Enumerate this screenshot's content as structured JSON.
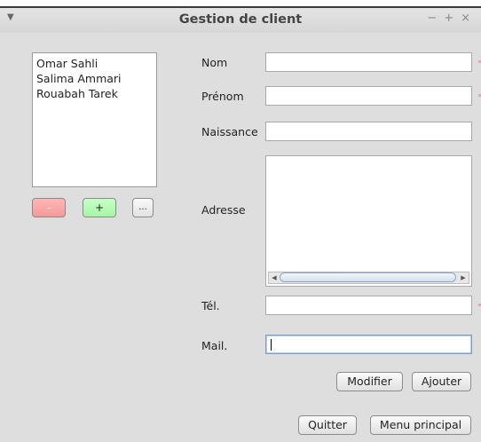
{
  "window": {
    "title": "Gestion de client",
    "menu_icon": "chevron-down-icon",
    "controls": [
      "−",
      "+",
      "×"
    ]
  },
  "clients": [
    "Omar Sahli",
    "Salima Ammari",
    "Rouabah Tarek"
  ],
  "list_buttons": {
    "remove": "-",
    "add": "+",
    "more": "..."
  },
  "form": {
    "nom_label": "Nom",
    "prenom_label": "Prénom",
    "naissance_label": "Naissance",
    "adresse_label": "Adresse",
    "tel_label": "Tél.",
    "mail_label": "Mail.",
    "nom_value": "",
    "prenom_value": "",
    "naissance_value": "",
    "adresse_value": "",
    "tel_value": "",
    "mail_value": ""
  },
  "actions": {
    "modifier": "Modifier",
    "ajouter": "Ajouter",
    "quitter": "Quitter",
    "menu_principal": "Menu principal"
  },
  "colors": {
    "remove_button": "#f59a9a",
    "add_button": "#a6f5a6",
    "focus_border": "#7a9ec7"
  }
}
